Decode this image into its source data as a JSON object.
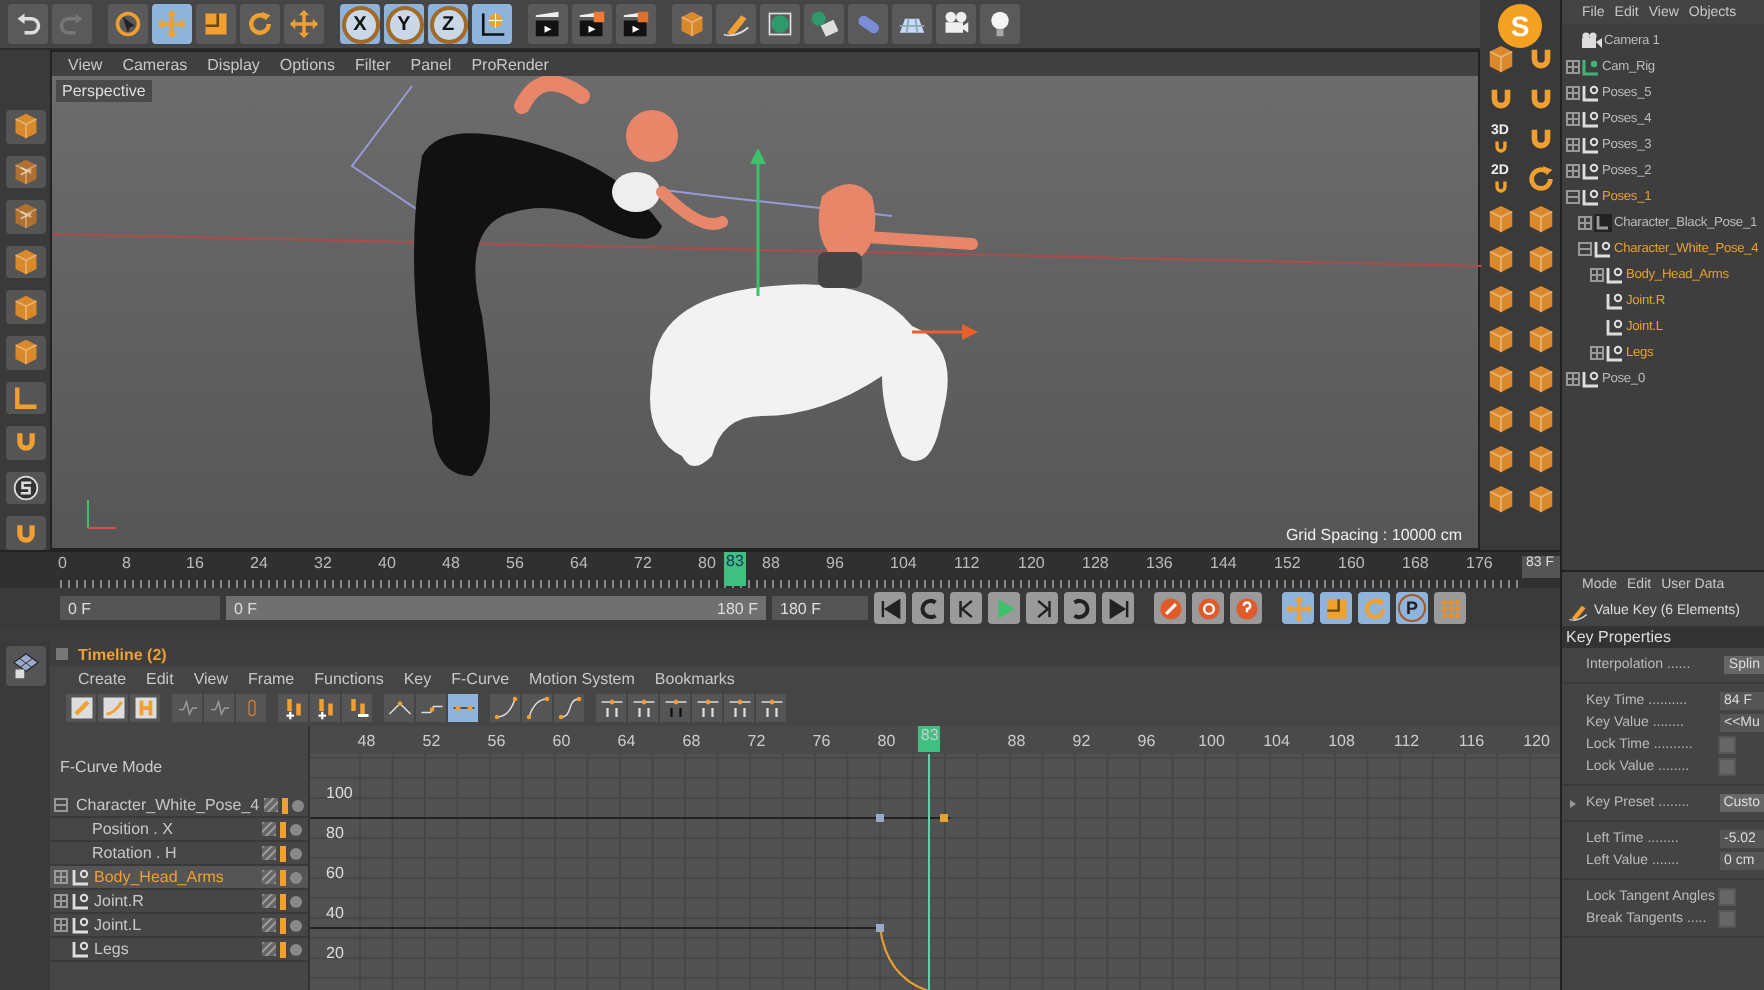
{
  "top_toolbar": [
    {
      "kind": "icon",
      "selected": false
    },
    {
      "kind": "icon",
      "selected": false
    },
    {
      "kind": "icon",
      "selected": false
    },
    {
      "kind": "icon",
      "selected": true
    },
    {
      "kind": "icon",
      "selected": false
    },
    {
      "kind": "icon",
      "selected": false
    },
    {
      "kind": "icon",
      "selected": false
    },
    {
      "kind": "axis",
      "label": "X",
      "selected": true
    },
    {
      "kind": "axis",
      "label": "Y",
      "selected": true
    },
    {
      "kind": "axis",
      "label": "Z",
      "selected": true
    },
    {
      "kind": "icon",
      "selected": true
    },
    {
      "kind": "icon",
      "selected": false
    },
    {
      "kind": "icon",
      "selected": false
    },
    {
      "kind": "icon",
      "selected": false
    },
    {
      "kind": "icon",
      "selected": false
    },
    {
      "kind": "icon",
      "selected": false
    },
    {
      "kind": "icon",
      "selected": false
    },
    {
      "kind": "icon",
      "selected": false
    },
    {
      "kind": "icon",
      "selected": false
    },
    {
      "kind": "icon",
      "selected": false
    },
    {
      "kind": "icon",
      "selected": false
    },
    {
      "kind": "icon",
      "selected": false
    }
  ],
  "viewport": {
    "menu": [
      "View",
      "Cameras",
      "Display",
      "Options",
      "Filter",
      "Panel",
      "ProRender"
    ],
    "label": "Perspective",
    "grid_spacing": "Grid Spacing : 10000 cm"
  },
  "right_bar": {
    "logo": "S",
    "labels": [
      "3D",
      "2D"
    ]
  },
  "object_manager": {
    "menu": [
      "File",
      "Edit",
      "View",
      "Objects"
    ],
    "tree": [
      {
        "name": "Camera 1",
        "kind": "camera",
        "selected": false
      },
      {
        "name": "Cam_Rig",
        "kind": "rig",
        "selected": false,
        "expanded": false
      },
      {
        "name": "Poses_5",
        "kind": "null",
        "selected": false,
        "expanded": false
      },
      {
        "name": "Poses_4",
        "kind": "null",
        "selected": false,
        "expanded": false
      },
      {
        "name": "Poses_3",
        "kind": "null",
        "selected": false,
        "expanded": false
      },
      {
        "name": "Poses_2",
        "kind": "null",
        "selected": false,
        "expanded": false
      },
      {
        "name": "Poses_1",
        "kind": "null",
        "selected": true,
        "expanded": true,
        "children": [
          {
            "name": "Character_Black_Pose_1",
            "kind": "dark",
            "selected": false,
            "expanded": false
          },
          {
            "name": "Character_White_Pose_4",
            "kind": "null",
            "selected": true,
            "expanded": true,
            "children": [
              {
                "name": "Body_Head_Arms",
                "kind": "null",
                "selected": true,
                "expanded": false
              },
              {
                "name": "Joint.R",
                "kind": "null",
                "selected": true
              },
              {
                "name": "Joint.L",
                "kind": "null",
                "selected": true
              },
              {
                "name": "Legs",
                "kind": "null",
                "selected": true,
                "expanded": false
              }
            ]
          }
        ]
      },
      {
        "name": "Pose_0",
        "kind": "null",
        "selected": false,
        "expanded": false
      }
    ]
  },
  "time_ruler": {
    "ticks": [
      "0",
      "8",
      "16",
      "24",
      "32",
      "40",
      "48",
      "56",
      "64",
      "72",
      "80",
      "88",
      "96",
      "104",
      "112",
      "120",
      "128",
      "136",
      "144",
      "152",
      "160",
      "168",
      "176"
    ],
    "current": "83",
    "frame_field": "83 F"
  },
  "transport": {
    "start": "0 F",
    "range_start": "0 F",
    "range_end": "180 F",
    "level": 1,
    "end": "180 F",
    "param_key": "P"
  },
  "attributes": {
    "menu": [
      "Mode",
      "Edit",
      "User Data"
    ],
    "title": "Value Key (6 Elements)",
    "section": "Key Properties",
    "groups": [
      [
        {
          "kind": "dropdown",
          "label": "Interpolation ......",
          "value": "Splin"
        }
      ],
      [
        {
          "kind": "field",
          "label": "Key Time ..........",
          "value": "84 F"
        },
        {
          "kind": "field",
          "label": "Key Value ........",
          "value": "<<Mu"
        },
        {
          "kind": "checkbox",
          "label": "Lock Time ..........",
          "checked": false
        },
        {
          "kind": "checkbox",
          "label": "Lock Value ........",
          "checked": false
        }
      ],
      [
        {
          "kind": "preset",
          "label": "Key Preset ........",
          "value": "Custo"
        }
      ],
      [
        {
          "kind": "field",
          "label": "Left  Time ........",
          "value": "-5.02"
        },
        {
          "kind": "field",
          "label": "Left  Value .......",
          "value": "0 cm"
        }
      ],
      [
        {
          "kind": "checkbox",
          "label": "Lock Tangent Angles",
          "checked": false
        },
        {
          "kind": "checkbox",
          "label": "Break Tangents .....",
          "checked": false
        }
      ]
    ]
  },
  "timeline": {
    "title": "Timeline (2)",
    "menu": [
      "Create",
      "Edit",
      "View",
      "Frame",
      "Functions",
      "Key",
      "F-Curve",
      "Motion System",
      "Bookmarks"
    ],
    "toolbar": [
      {
        "selected": false
      },
      {
        "selected": false
      },
      {
        "selected": false
      },
      {
        "selected": false
      },
      {
        "selected": false
      },
      {
        "selected": false
      },
      {
        "selected": false
      },
      {
        "selected": false
      },
      {
        "selected": false
      },
      {
        "selected": false
      },
      {
        "selected": false
      },
      {
        "selected": true
      },
      {
        "selected": false
      },
      {
        "selected": false
      },
      {
        "selected": false
      },
      {
        "selected": false
      },
      {
        "selected": false
      },
      {
        "selected": false
      },
      {
        "selected": false
      },
      {
        "selected": false
      },
      {
        "selected": false
      }
    ],
    "mode": "F-Curve Mode",
    "tracks": [
      {
        "name": "Character_White_Pose_4",
        "selected": false,
        "expanded": true,
        "children": [
          {
            "name": "Position . X",
            "selected": false
          },
          {
            "name": "Rotation . H",
            "selected": false
          }
        ]
      },
      {
        "name": "Body_Head_Arms",
        "selected": true,
        "expanded": false
      },
      {
        "name": "Joint.R",
        "selected": false,
        "expanded": false
      },
      {
        "name": "Joint.L",
        "selected": false,
        "expanded": false
      },
      {
        "name": "Legs",
        "selected": false
      }
    ],
    "ruler": [
      "48",
      "52",
      "56",
      "60",
      "64",
      "68",
      "72",
      "76",
      "80",
      "88",
      "92",
      "96",
      "100",
      "104",
      "108",
      "112",
      "116",
      "120"
    ],
    "current": "83",
    "value_ticks": [
      "100",
      "80",
      "60",
      "40",
      "20"
    ]
  }
}
